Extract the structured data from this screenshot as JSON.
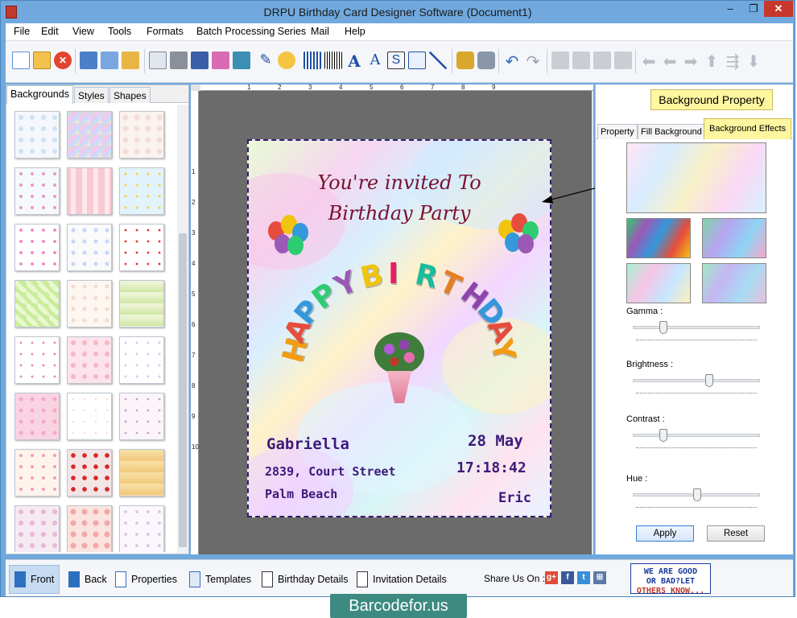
{
  "window": {
    "title": "DRPU Birthday Card Designer Software (Document1)",
    "min": "–",
    "max": "❐",
    "close": "✕"
  },
  "menu": [
    "File",
    "Edit",
    "View",
    "Tools",
    "Formats",
    "Batch Processing Series",
    "Mail",
    "Help"
  ],
  "left_panel": {
    "tabs": [
      "Backgrounds",
      "Styles",
      "Shapes"
    ],
    "active_tab": "Backgrounds"
  },
  "ruler": {
    "h_ticks": [
      "1",
      "2",
      "3",
      "4",
      "5",
      "6",
      "7",
      "8",
      "9"
    ],
    "v_ticks": [
      "1",
      "2",
      "3",
      "4",
      "5",
      "6",
      "7",
      "8",
      "9",
      "10"
    ]
  },
  "card": {
    "invite_line1": "You're invited To",
    "invite_line2": "Birthday Party",
    "happy_birthday_letters": [
      "H",
      "A",
      "P",
      "P",
      "Y",
      "B",
      "I",
      "R",
      "T",
      "H",
      "D",
      "A",
      "Y"
    ],
    "name": "Gabriella",
    "address1": "2839, Court Street",
    "address2": "Palm Beach",
    "date": "28 May",
    "time": "17:18:42",
    "from": "Eric"
  },
  "right_panel": {
    "title_button": "Background Property",
    "tabs": [
      "Property",
      "Fill Background",
      "Background Effects"
    ],
    "active_tab": "Background Effects",
    "sliders": [
      {
        "label": "Gamma :",
        "value": 0.22
      },
      {
        "label": "Brightness :",
        "value": 0.6
      },
      {
        "label": "Contrast :",
        "value": 0.22
      },
      {
        "label": "Hue :",
        "value": 0.5
      }
    ],
    "apply": "Apply",
    "reset": "Reset"
  },
  "bottom_nav": [
    "Front",
    "Back",
    "Properties",
    "Templates",
    "Birthday Details",
    "Invitation Details"
  ],
  "share_label": "Share Us On :",
  "share_icons": [
    "google-plus-icon",
    "facebook-icon",
    "twitter-icon",
    "windows-icon"
  ],
  "feedback_line1": "WE ARE GOOD",
  "feedback_line2": "OR BAD?LET",
  "feedback_line3": "OTHERS KNOW...",
  "footer_brand": "Barcodefor.us",
  "colors": {
    "accent": "#71a9df",
    "highlight": "#fff6a0",
    "card_text": "#7a1030",
    "hand_text": "#3d1a7a"
  }
}
